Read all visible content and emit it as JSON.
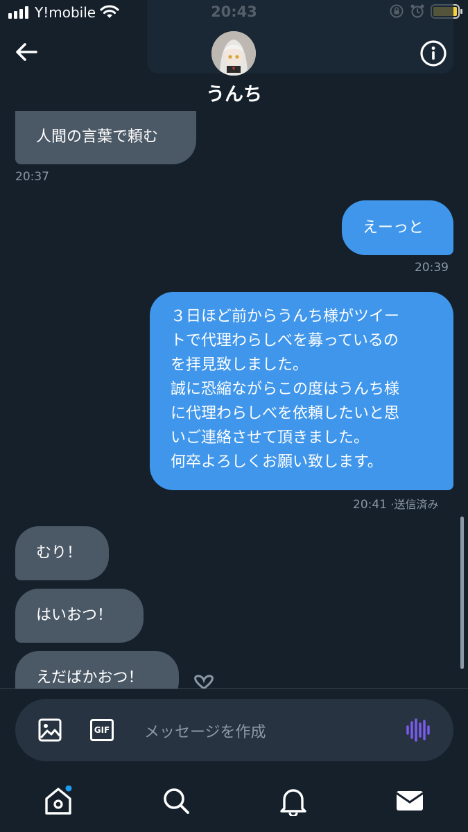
{
  "status_bar": {
    "carrier": "Y!mobile",
    "time": "20:43",
    "battery_color": "#f7d23e"
  },
  "header": {
    "name": "うんち",
    "back_icon": "back-arrow-icon",
    "info_icon": "info-icon"
  },
  "messages": [
    {
      "dir": "in",
      "text": "人間の言葉で頼む"
    },
    {
      "time": "20:37"
    },
    {
      "dir": "out",
      "text": "えーっと"
    },
    {
      "time": "20:39"
    },
    {
      "dir": "out",
      "lines": [
        "３日ほど前からうんち様がツイー",
        "トで代理わらしべを募っているの",
        "を拝見致しました。",
        "誠に恐縮ながらこの度はうんち様",
        "に代理わらしべを依頼したいと思",
        "いご連絡させて頂きました。",
        "何卒よろしくお願い致します。"
      ]
    },
    {
      "time": "20:41",
      "status": "·送信済み"
    },
    {
      "dir": "in",
      "text": "むり！"
    },
    {
      "dir": "in",
      "text": "はいおつ！"
    },
    {
      "dir": "in",
      "text": "えだばかおつ！"
    }
  ],
  "composer": {
    "placeholder": "メッセージを作成",
    "gif_label": "GIF",
    "image_icon": "image-icon",
    "voice_icon": "voice-wave-icon"
  },
  "tabs": [
    {
      "name": "home",
      "icon": "home-icon",
      "has_badge": true
    },
    {
      "name": "search",
      "icon": "search-icon"
    },
    {
      "name": "notifications",
      "icon": "bell-icon"
    },
    {
      "name": "messages",
      "icon": "mail-icon",
      "active": true
    }
  ],
  "colors": {
    "background": "#15202b",
    "incoming_bubble": "#4b5866",
    "outgoing_bubble": "#3f96eb",
    "timestamp": "#8b98a5",
    "accent_voice": "#7b5cf0",
    "badge": "#1d9bf0"
  }
}
